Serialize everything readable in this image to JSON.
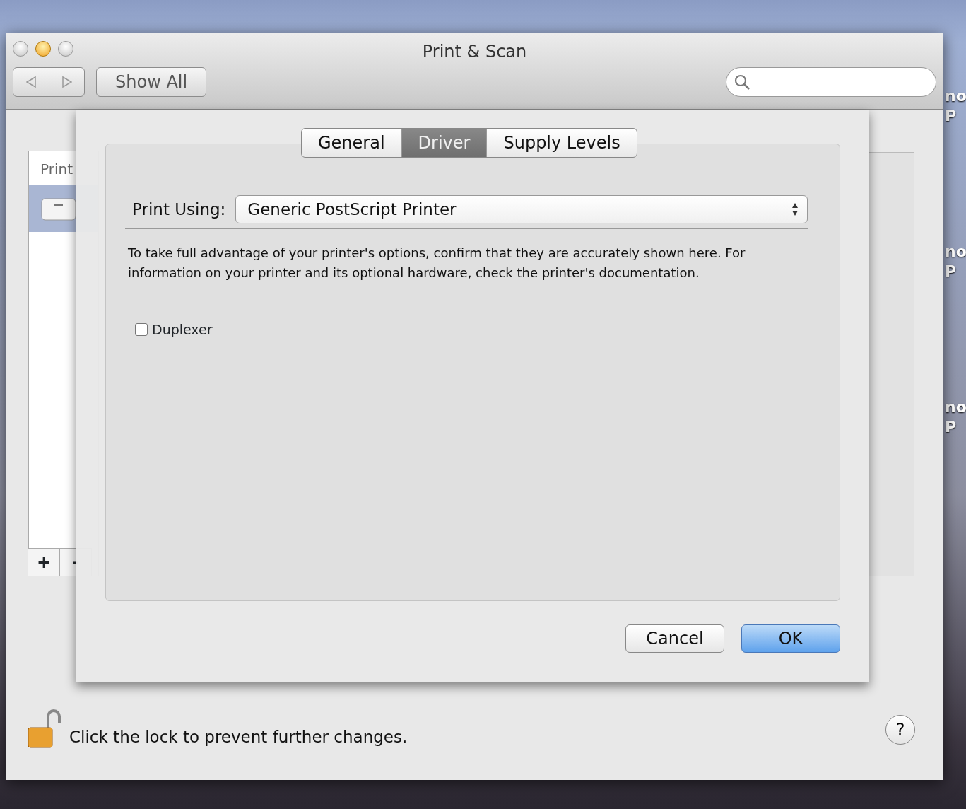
{
  "window": {
    "title": "Print & Scan",
    "show_all": "Show All"
  },
  "background": {
    "list_header": "Print",
    "add": "+",
    "remove": "-"
  },
  "sheet": {
    "tabs": [
      {
        "label": "General",
        "selected": false
      },
      {
        "label": "Driver",
        "selected": true
      },
      {
        "label": "Supply Levels",
        "selected": false
      }
    ],
    "print_using": {
      "label": "Print Using:",
      "value": "Generic PostScript Printer"
    },
    "description": "To take full advantage of your printer's options, confirm that they are accurately shown here. For information on your printer and its optional hardware, check the printer's documentation.",
    "options": [
      {
        "label": "Duplexer",
        "checked": false
      }
    ],
    "buttons": [
      {
        "label": "Cancel",
        "kind": "normal"
      },
      {
        "label": "OK",
        "kind": "default"
      }
    ]
  },
  "lock": {
    "text": "Click the lock to prevent further changes.",
    "locked": false
  },
  "help": "?",
  "desktop_labels": [
    {
      "line1": "no",
      "line2": "P"
    },
    {
      "line1": "no",
      "line2": "P"
    },
    {
      "line1": "no",
      "line2": "P"
    }
  ]
}
